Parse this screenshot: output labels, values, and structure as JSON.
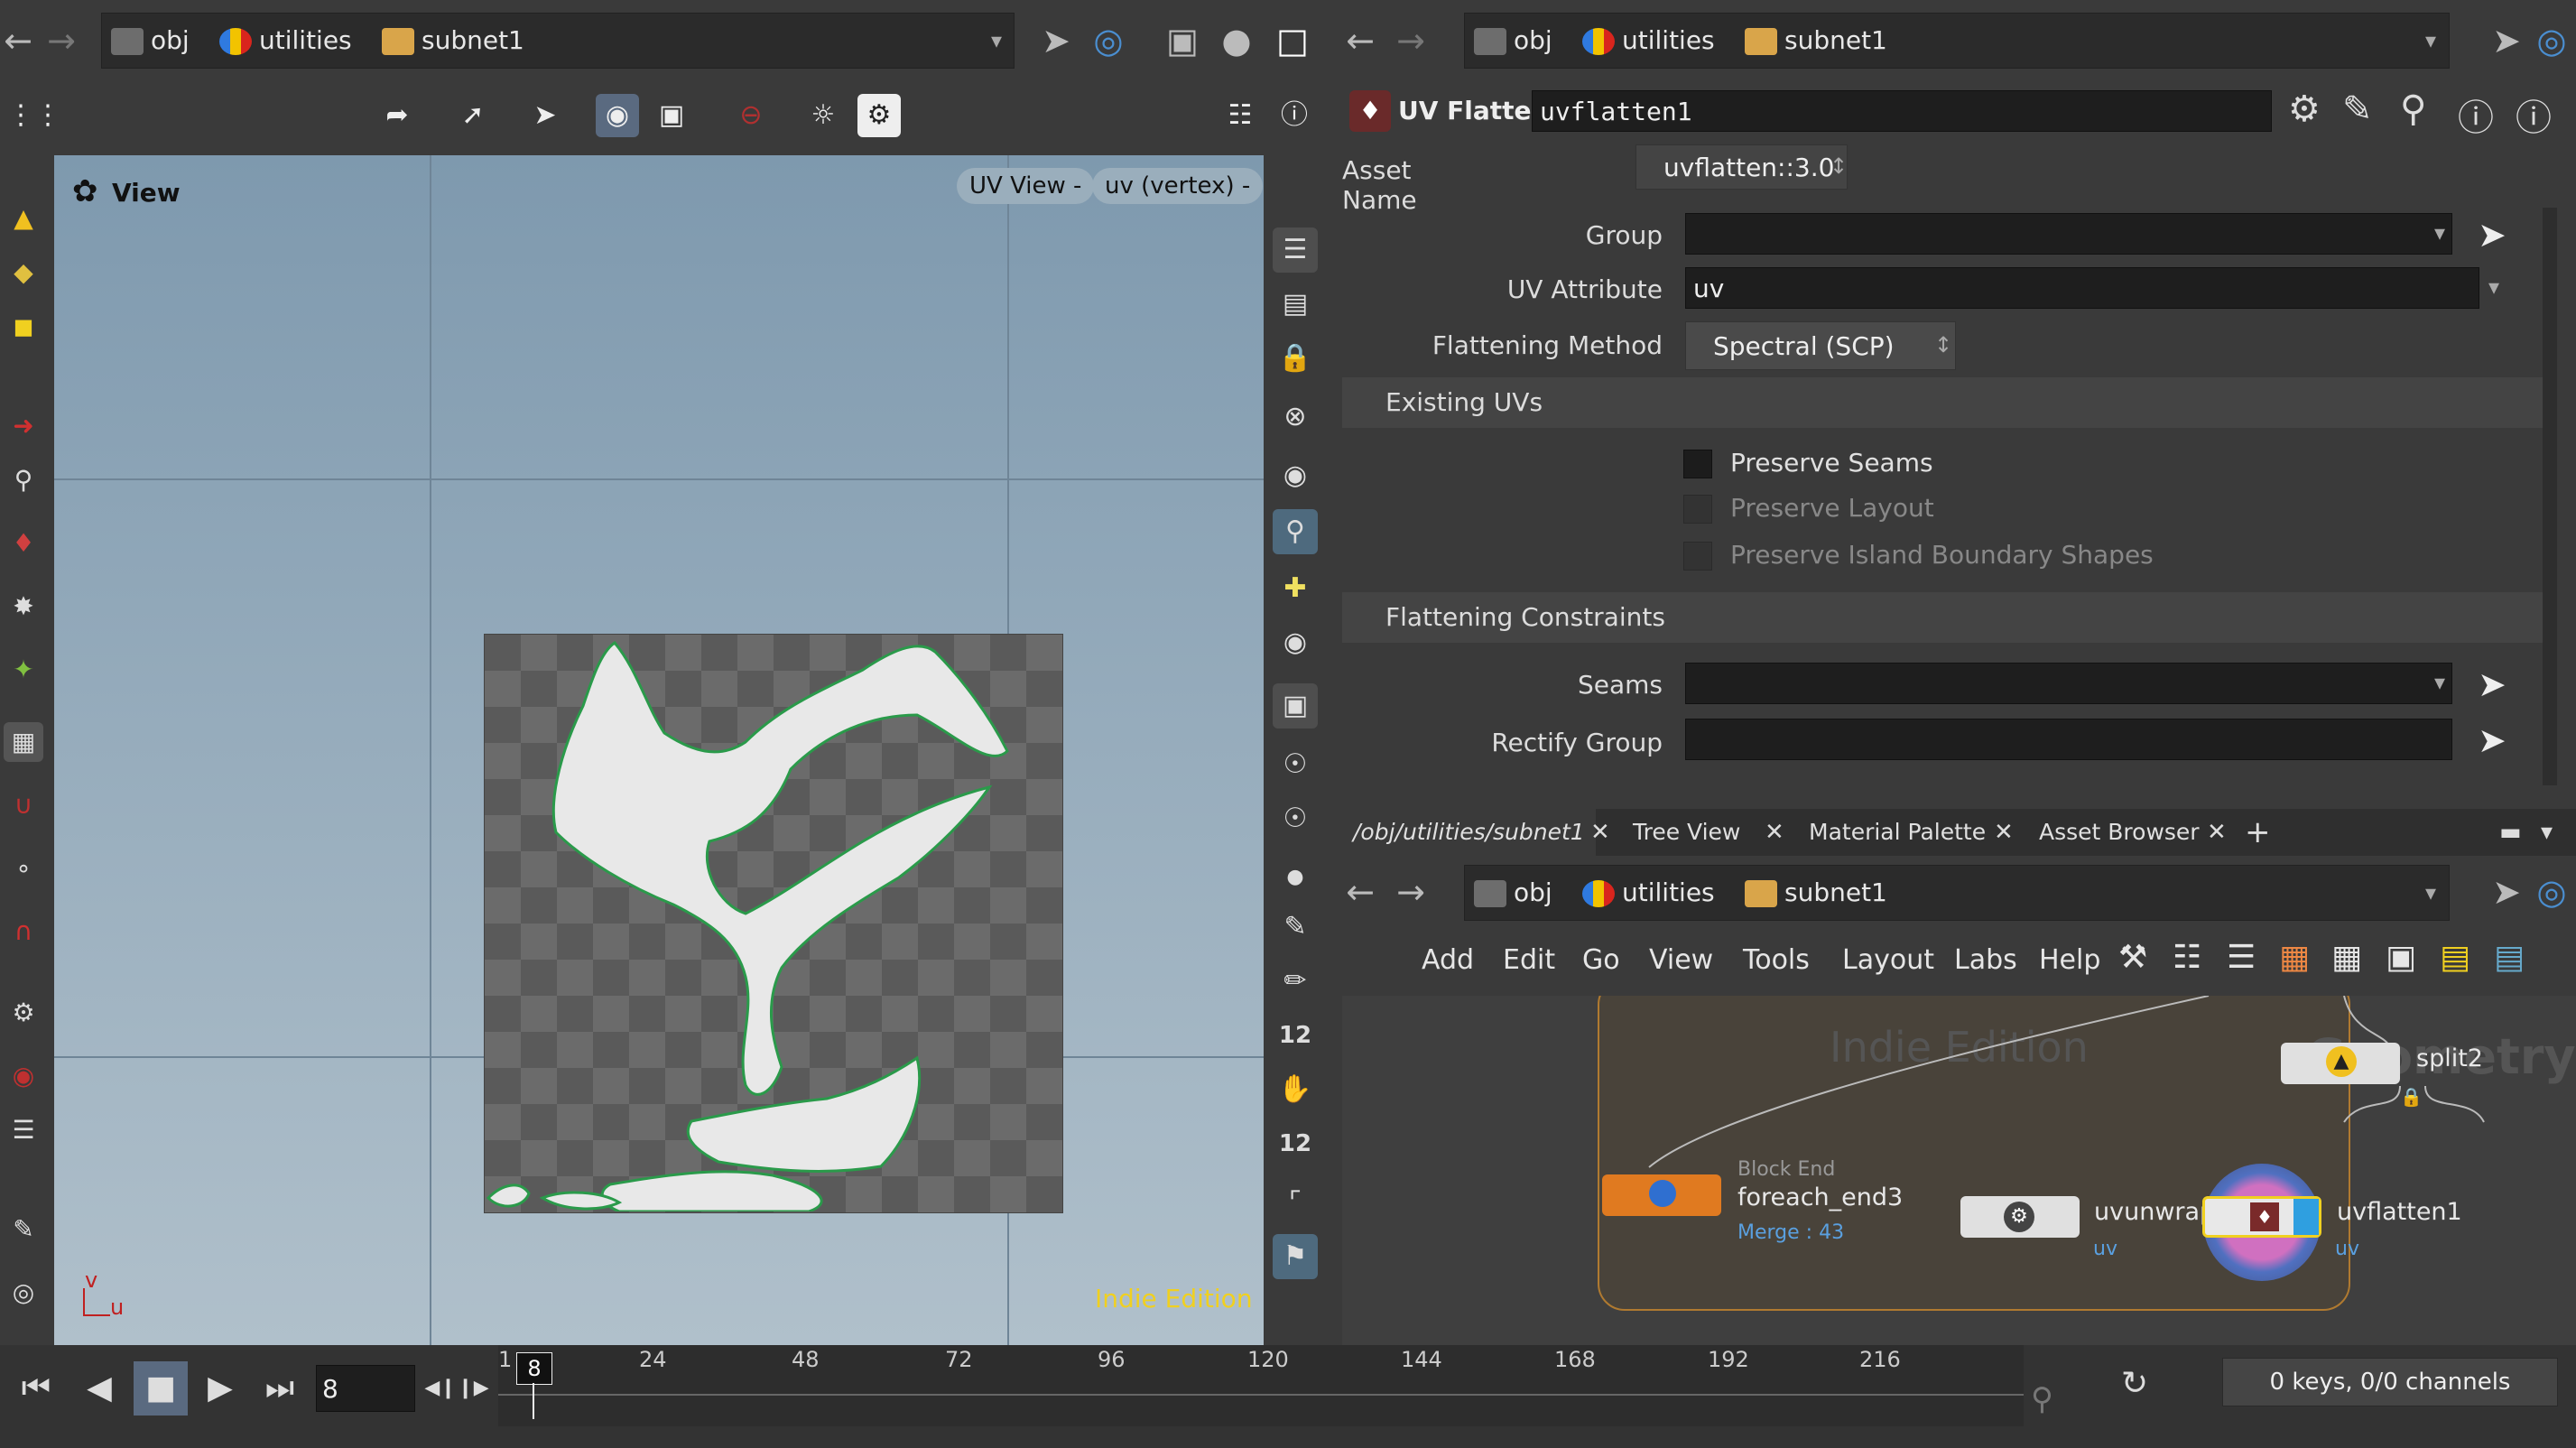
{
  "path": {
    "obj": "obj",
    "utilities": "utilities",
    "subnet": "subnet1"
  },
  "viewport": {
    "title": "View",
    "uv_view_label": "UV View",
    "uv_vertex_label": "uv (vertex)",
    "watermark": "Indie Edition",
    "axis_v": "v",
    "axis_u": "u"
  },
  "params": {
    "node_type": "UV Flatten",
    "node_name": "uvflatten1",
    "asset_name_label": "Asset Name",
    "asset_name_value": "uvflatten::3.0",
    "group_label": "Group",
    "group_value": "",
    "uv_attribute_label": "UV Attribute",
    "uv_attribute_value": "uv",
    "flattening_method_label": "Flattening Method",
    "flattening_method_value": "Spectral (SCP)",
    "existing_uvs_label": "Existing UVs",
    "preserve_seams": "Preserve Seams",
    "preserve_layout": "Preserve Layout",
    "preserve_island": "Preserve Island Boundary Shapes",
    "flattening_constraints_label": "Flattening Constraints",
    "seams_label": "Seams",
    "rectify_group_label": "Rectify Group"
  },
  "tabs": [
    {
      "label": "/obj/utilities/subnet1"
    },
    {
      "label": "Tree View"
    },
    {
      "label": "Material Palette"
    },
    {
      "label": "Asset Browser"
    }
  ],
  "network_menu": [
    "Add",
    "Edit",
    "Go",
    "View",
    "Tools",
    "Layout",
    "Labs",
    "Help"
  ],
  "network": {
    "watermark_indie": "Indie Edition",
    "watermark_geo": "Geometry",
    "split_node": "split2",
    "block_end_label": "Block End",
    "foreach_node": "foreach_end3",
    "merge_label": "Merge : 43",
    "uvunwrap_node": "uvunwrap",
    "uvflatten_node": "uvflatten1",
    "uv_tag": "uv"
  },
  "timeline": {
    "current_frame": "8",
    "playhead_frame": "8",
    "frame_start": "1",
    "ticks": [
      "24",
      "48",
      "72",
      "96",
      "120",
      "144",
      "168",
      "192",
      "216"
    ],
    "keys_status": "0 keys, 0/0 channels"
  },
  "colors": {
    "viewport_top": "#7e99ae",
    "viewport_bottom": "#b0c0cb",
    "watermark": "#f0d020",
    "node_orange": "#e07a20",
    "node_selected": "#2f9fe0"
  }
}
